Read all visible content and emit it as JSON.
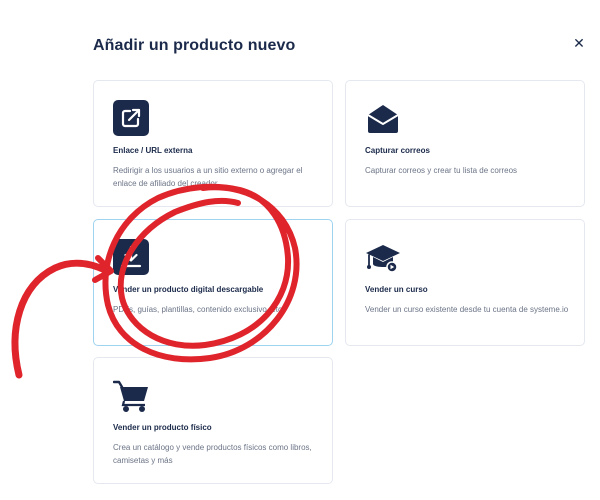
{
  "modal": {
    "title": "Añadir un producto nuevo",
    "close_icon": "close-icon"
  },
  "cards": [
    {
      "id": "external-link",
      "icon": "external-link-icon",
      "name": "Enlace / URL externa",
      "description": "Redirigir a los usuarios a un sitio externo o agregar el enlace de afiliado del creador"
    },
    {
      "id": "capture-emails",
      "icon": "envelope-icon",
      "name": "Capturar correos",
      "description": "Capturar correos y crear tu lista de correos"
    },
    {
      "id": "digital-download",
      "icon": "download-icon",
      "name": "Vender un producto digital descargable",
      "description": "PDFs, guías, plantillas, contenido exclusivo, etc.",
      "selected": true
    },
    {
      "id": "course",
      "icon": "graduation-cap-icon",
      "name": "Vender un curso",
      "description": "Vender un curso existente desde tu cuenta de systeme.io"
    },
    {
      "id": "physical-product",
      "icon": "shopping-cart-icon",
      "name": "Vender un producto físico",
      "description": "Crea un catálogo y vende productos físicos como libros, camisetas y más"
    }
  ],
  "colors": {
    "navy": "#1b2a4a",
    "muted_text": "#6b7486",
    "card_border": "#e5e8ef",
    "selected_border": "#9fd3ef",
    "annotation_red": "#e0242c"
  },
  "annotation": {
    "icons": [
      "red-circle-annotation",
      "red-arrow-annotation"
    ]
  }
}
